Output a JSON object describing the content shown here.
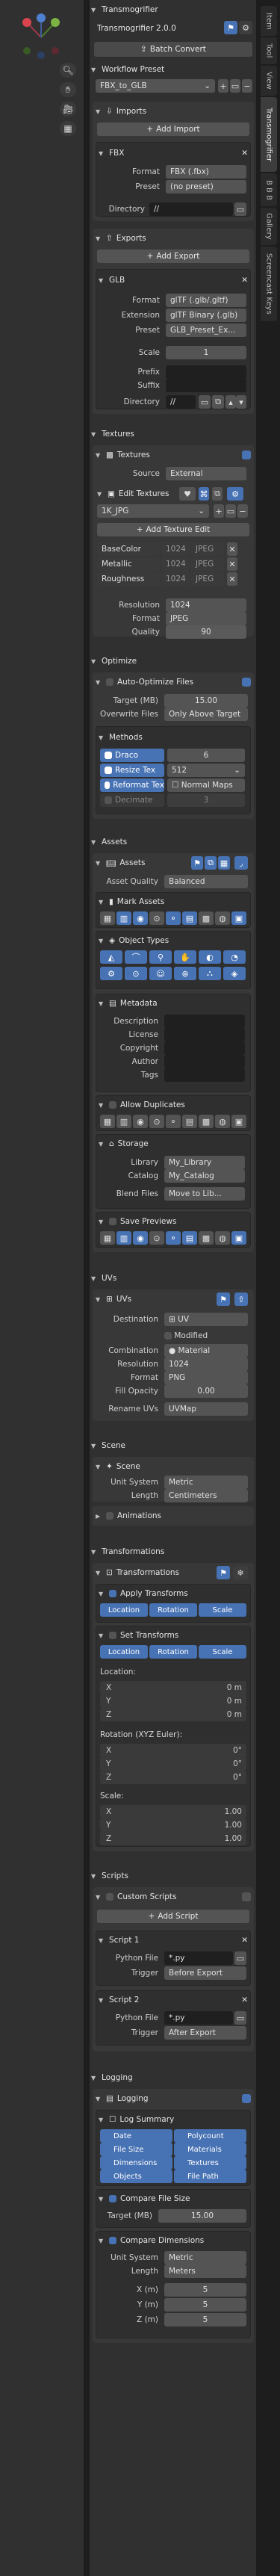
{
  "nav_buttons": [
    "magnify-icon",
    "hand-icon",
    "camera-icon",
    "grid-icon"
  ],
  "tabs": [
    "Item",
    "Tool",
    "View",
    "Transmogrifier",
    "B B B",
    "Gallery",
    "Screencast Keys"
  ],
  "main": {
    "title": "Transmogrifier",
    "version": "Transmogrifier 2.0.0",
    "batch_convert": "Batch Convert"
  },
  "workflow": {
    "title": "Workflow Preset",
    "preset": "FBX_to_GLB"
  },
  "imports": {
    "title": "Imports",
    "add": "Add Import",
    "fbx_title": "FBX",
    "format_label": "Format",
    "format_value": "FBX (.fbx)",
    "preset_label": "Preset",
    "preset_value": "(no preset)",
    "directory_label": "Directory",
    "directory_value": "//"
  },
  "exports": {
    "title": "Exports",
    "add": "Add Export",
    "glb_title": "GLB",
    "format_label": "Format",
    "format_value": "glTF (.glb/.gltf)",
    "extension_label": "Extension",
    "extension_value": "glTF Binary (.glb)",
    "preset_label": "Preset",
    "preset_value": "GLB_Preset_Ex...",
    "scale_label": "Scale",
    "scale_value": "1",
    "prefix_label": "Prefix",
    "suffix_label": "Suffix",
    "directory_label": "Directory",
    "directory_value": "//"
  },
  "textures": {
    "title": "Textures",
    "panel": "Textures",
    "source_label": "Source",
    "source_value": "External",
    "edit_textures": "Edit Textures",
    "list_value": "1K_JPG",
    "add_edit": "Add Texture Edit",
    "maps": [
      {
        "name": "BaseColor",
        "size": "1024",
        "fmt": "JPEG"
      },
      {
        "name": "Metallic",
        "size": "1024",
        "fmt": "JPEG"
      },
      {
        "name": "Roughness",
        "size": "1024",
        "fmt": "JPEG"
      }
    ],
    "resolution_label": "Resolution",
    "resolution_value": "1024",
    "format_label": "Format",
    "format_value": "JPEG",
    "quality_label": "Quality",
    "quality_value": "90"
  },
  "optimize": {
    "title": "Optimize",
    "auto": "Auto-Optimize Files",
    "target_label": "Target (MB)",
    "target_value": "15.00",
    "overwrite_label": "Overwrite Files",
    "overwrite_value": "Only Above Target",
    "methods": "Methods",
    "draco": "Draco",
    "draco_value": "6",
    "resize": "Resize Tex",
    "resize_value": "512",
    "reformat": "Reformat Tex",
    "reformat_value": "Normal Maps",
    "decimate": "Decimate",
    "decimate_value": "3"
  },
  "assets": {
    "title": "Assets",
    "panel": "Assets",
    "quality_label": "Asset Quality",
    "quality_value": "Balanced",
    "mark_assets": "Mark Assets",
    "object_types": "Object Types",
    "metadata": "Metadata",
    "meta_fields": [
      "Description",
      "License",
      "Copyright",
      "Author",
      "Tags"
    ],
    "allow_duplicates": "Allow Duplicates",
    "storage": "Storage",
    "library_label": "Library",
    "library_value": "My_Library",
    "catalog_label": "Catalog",
    "catalog_value": "My_Catalog",
    "blend_label": "Blend Files",
    "blend_value": "Move to Lib...",
    "save_previews": "Save Previews"
  },
  "uvs": {
    "title": "UVs",
    "panel": "UVs",
    "destination_label": "Destination",
    "destination_value": "UV",
    "modified": "Modified",
    "combination_label": "Combination",
    "combination_value": "Material",
    "resolution_label": "Resolution",
    "resolution_value": "1024",
    "format_label": "Format",
    "format_value": "PNG",
    "fill_label": "Fill Opacity",
    "fill_value": "0.00",
    "rename_label": "Rename UVs",
    "rename_value": "UVMap"
  },
  "scene": {
    "title": "Scene",
    "panel": "Scene",
    "unit_label": "Unit System",
    "unit_value": "Metric",
    "length_label": "Length",
    "length_value": "Centimeters",
    "animations": "Animations"
  },
  "transforms": {
    "title": "Transformations",
    "panel": "Transformations",
    "apply": "Apply Transforms",
    "set": "Set Transforms",
    "buttons": [
      "Location",
      "Rotation",
      "Scale"
    ],
    "location": "Location:",
    "rotation": "Rotation (XYZ Euler):",
    "scale": "Scale:",
    "loc_vals": [
      {
        "axis": "X",
        "v": "0 m"
      },
      {
        "axis": "Y",
        "v": "0 m"
      },
      {
        "axis": "Z",
        "v": "0 m"
      }
    ],
    "rot_vals": [
      {
        "axis": "X",
        "v": "0°"
      },
      {
        "axis": "Y",
        "v": "0°"
      },
      {
        "axis": "Z",
        "v": "0°"
      }
    ],
    "scale_vals": [
      {
        "axis": "X",
        "v": "1.00"
      },
      {
        "axis": "Y",
        "v": "1.00"
      },
      {
        "axis": "Z",
        "v": "1.00"
      }
    ]
  },
  "scripts": {
    "title": "Scripts",
    "panel": "Custom Scripts",
    "add": "Add Script",
    "items": [
      {
        "name": "Script 1",
        "file_label": "Python File",
        "file": "*.py",
        "trigger_label": "Trigger",
        "trigger": "Before Export"
      },
      {
        "name": "Script 2",
        "file_label": "Python File",
        "file": "*.py",
        "trigger_label": "Trigger",
        "trigger": "After Export"
      }
    ]
  },
  "logging": {
    "title": "Logging",
    "panel": "Logging",
    "summary": "Log Summary",
    "summary_items": [
      "Date",
      "Polycount",
      "File Size",
      "Materials",
      "Dimensions",
      "Textures",
      "Objects",
      "File Path"
    ],
    "compare_size": "Compare File Size",
    "target_label": "Target (MB)",
    "target_value": "15.00",
    "compare_dims": "Compare Dimensions",
    "unit_label": "Unit System",
    "unit_value": "Metric",
    "length_label": "Length",
    "length_value": "Meters",
    "dims": [
      {
        "axis": "X (m)",
        "v": "5"
      },
      {
        "axis": "Y (m)",
        "v": "5"
      },
      {
        "axis": "Z (m)",
        "v": "5"
      }
    ]
  },
  "colors": {
    "accent": "#4772b3",
    "panel": "#303030",
    "field": "#545454",
    "bg": "#1d1d1d"
  }
}
